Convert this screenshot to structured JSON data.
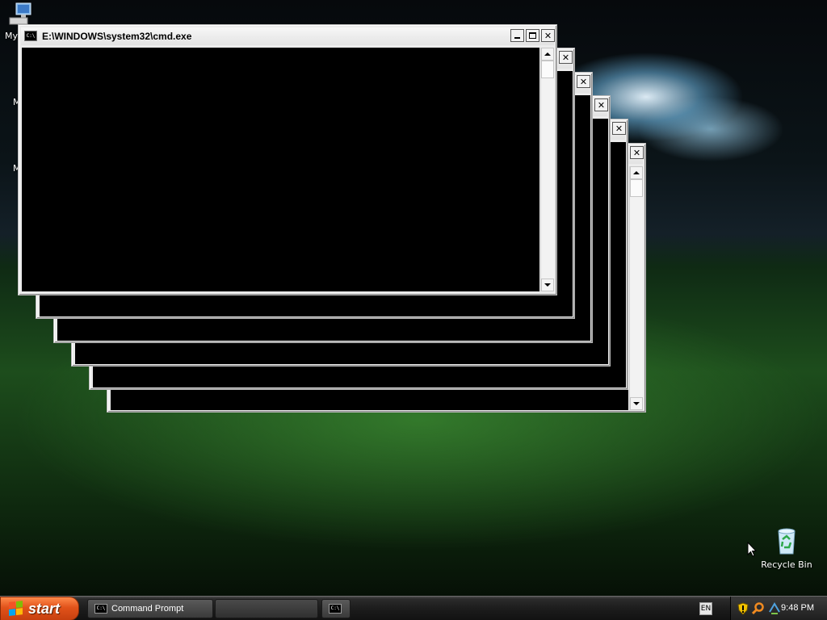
{
  "desktop": {
    "icons": {
      "my_computer_label": "My",
      "my_documents_partial": "M",
      "my_network_partial": "M",
      "recycle_bin_label": "Recycle Bin"
    }
  },
  "window": {
    "title": "E:\\WINDOWS\\system32\\cmd.exe",
    "icon_glyph": "C:\\",
    "console_bg": "#000000"
  },
  "taskbar": {
    "start_label": "start",
    "tasks": [
      {
        "label": "Command Prompt"
      },
      {
        "label": ""
      }
    ],
    "tray": {
      "lang": "EN",
      "clock": "9:48 PM"
    }
  },
  "colors": {
    "start_button": "#e1521a",
    "taskbar": "#1c1c1c"
  }
}
